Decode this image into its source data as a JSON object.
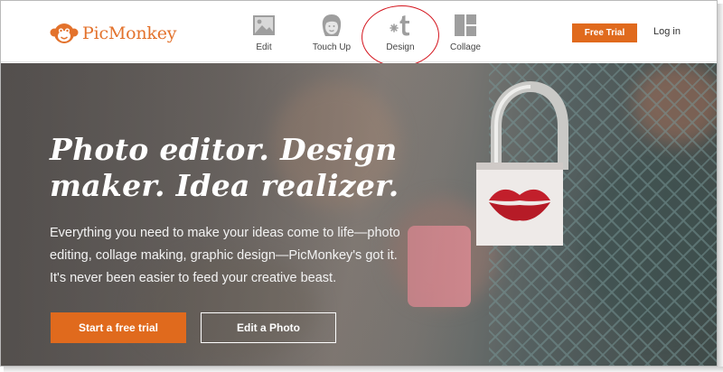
{
  "brand": {
    "name": "PicMonkey",
    "accent": "#e06a1d",
    "logo_icon": "monkey-icon"
  },
  "nav": {
    "items": [
      {
        "label": "Edit",
        "icon": "image-icon"
      },
      {
        "label": "Touch Up",
        "icon": "face-icon"
      },
      {
        "label": "Design",
        "icon": "design-t-icon"
      },
      {
        "label": "Collage",
        "icon": "collage-grid-icon"
      }
    ],
    "free_trial_label": "Free Trial",
    "login_label": "Log in"
  },
  "annotation": {
    "color": "#d4141d",
    "target": "Design"
  },
  "hero": {
    "headline_line1": "Photo editor. Design",
    "headline_line2": "maker. Idea realizer.",
    "sub_line1": "Everything you need to make your ideas come to life—photo",
    "sub_line2": "editing, collage making, graphic design—PicMonkey's got it.",
    "sub_line3": "It's never been easier to feed your creative beast.",
    "primary_cta": "Start a free trial",
    "secondary_cta": "Edit a Photo"
  }
}
